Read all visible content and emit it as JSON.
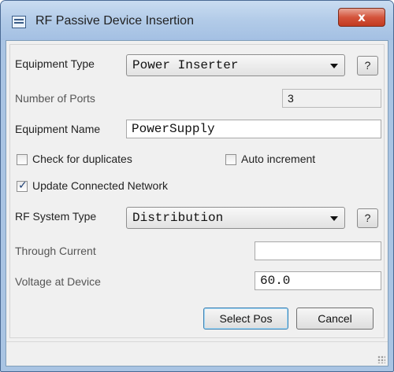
{
  "window": {
    "title": "RF Passive Device Insertion",
    "close_label": "x"
  },
  "form": {
    "equipment_type_label": "Equipment Type",
    "equipment_type_value": "Power Inserter",
    "help_label": "?",
    "number_of_ports_label": "Number of Ports",
    "number_of_ports_value": "3",
    "equipment_name_label": "Equipment Name",
    "equipment_name_value": "PowerSupply",
    "check_duplicates_label": "Check for duplicates",
    "check_duplicates_checked": false,
    "auto_increment_label": "Auto increment",
    "auto_increment_checked": false,
    "update_network_label": "Update Connected Network",
    "update_network_checked": true,
    "rf_system_type_label": "RF System Type",
    "rf_system_type_value": "Distribution",
    "through_current_label": "Through Current",
    "through_current_value": "",
    "voltage_label": "Voltage at Device",
    "voltage_value": "60.0"
  },
  "buttons": {
    "select_pos_label": "Select Pos",
    "cancel_label": "Cancel"
  },
  "colors": {
    "title_bar": "#b2cbe8",
    "close_button": "#d4543c",
    "dialog_background": "#f0f0f0"
  },
  "icons": {
    "app": "app-icon",
    "close": "close-icon",
    "dropdown": "chevron-down-icon",
    "check": "check-icon",
    "grip": "resize-grip-icon"
  }
}
